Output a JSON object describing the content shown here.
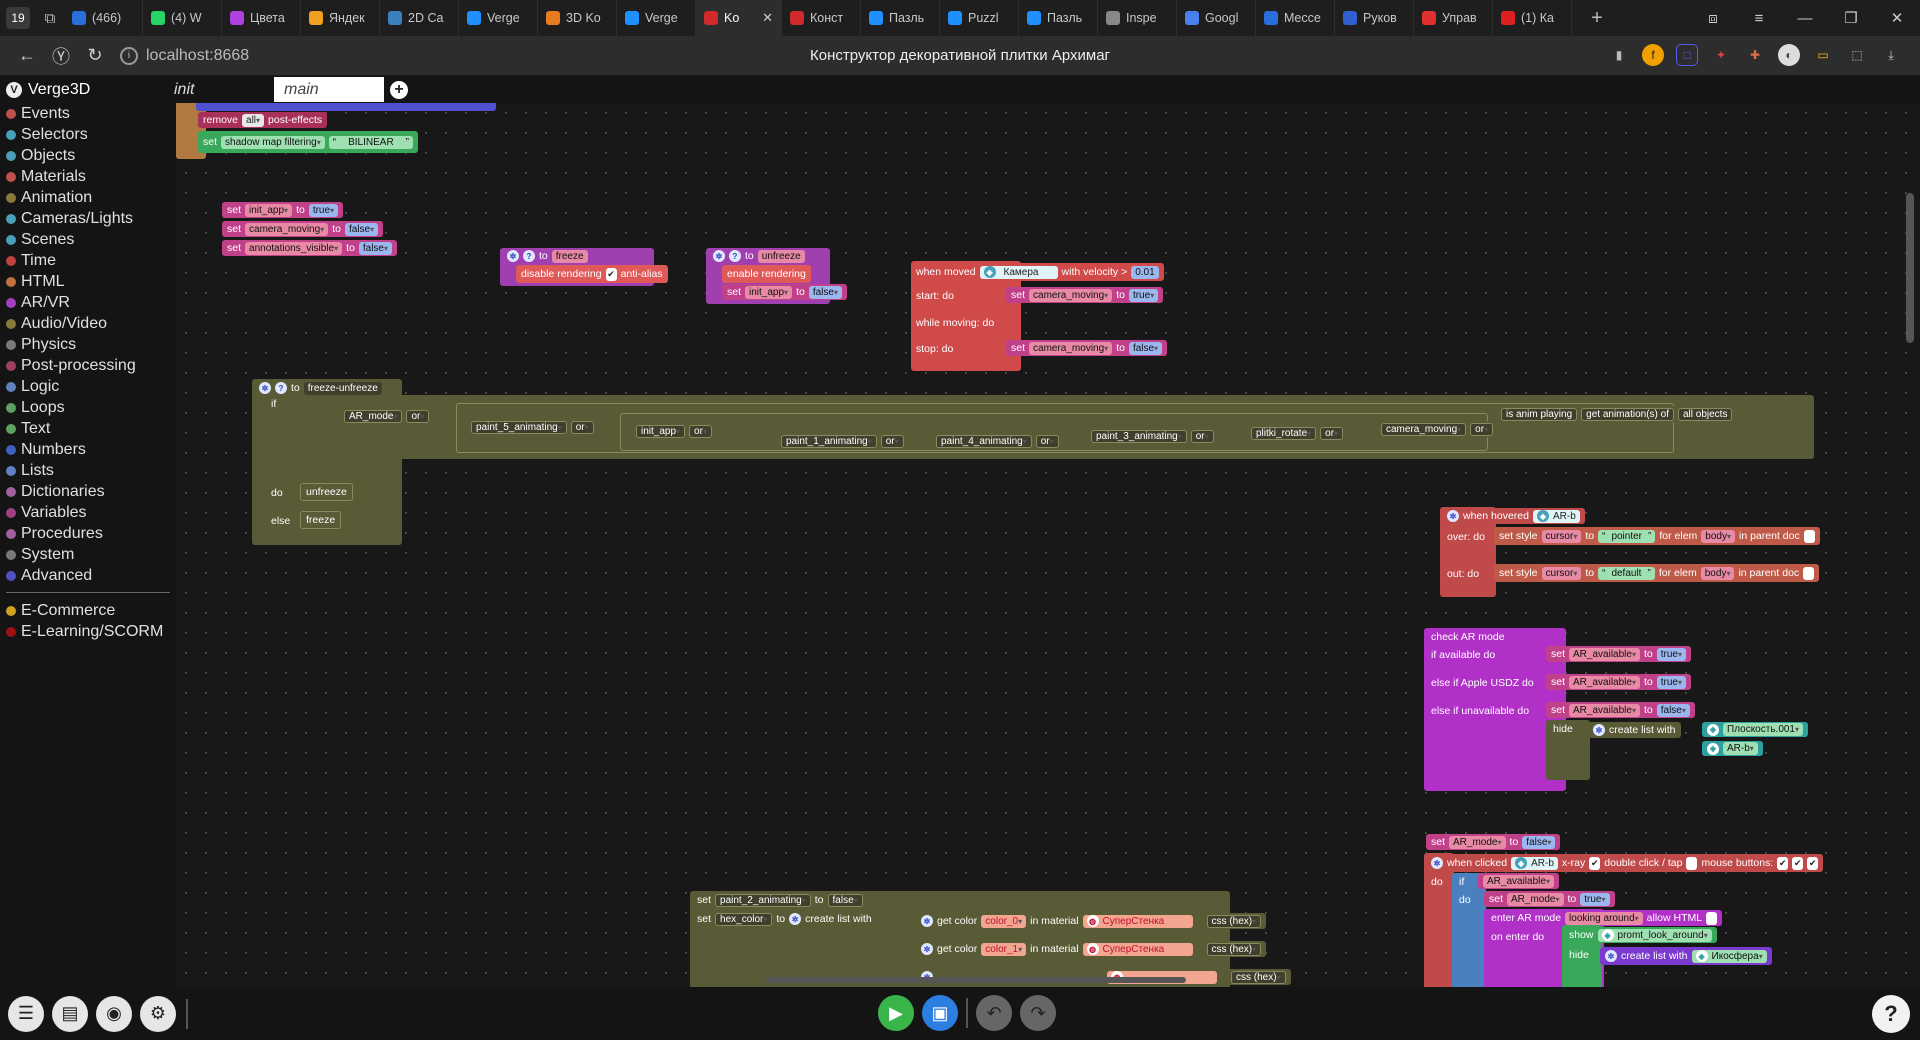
{
  "browser": {
    "tab_count": "19",
    "tabs": [
      {
        "label": "(466)",
        "color": "#2a6edc"
      },
      {
        "label": "(4) W",
        "color": "#25d366"
      },
      {
        "label": "Цвета",
        "color": "#b040e0"
      },
      {
        "label": "Яндек",
        "color": "#f0a020"
      },
      {
        "label": "2D Ca",
        "color": "#3a80c0"
      },
      {
        "label": "Verge",
        "color": "#1e90ff"
      },
      {
        "label": "3D Ko",
        "color": "#e87a20"
      },
      {
        "label": "Verge",
        "color": "#1e90ff"
      },
      {
        "label": "Ko",
        "color": "#d02a2a"
      },
      {
        "label": "Конст",
        "color": "#d02a2a"
      },
      {
        "label": "Пазль",
        "color": "#1e90ff"
      },
      {
        "label": "Puzzl",
        "color": "#1e90ff"
      },
      {
        "label": "Пазль",
        "color": "#1e90ff"
      },
      {
        "label": "Inspe",
        "color": "#888888"
      },
      {
        "label": "Googl",
        "color": "#4a80f0"
      },
      {
        "label": "Mecce",
        "color": "#2a6edc"
      },
      {
        "label": "Руков",
        "color": "#3060d0"
      },
      {
        "label": "Управ",
        "color": "#e03030"
      },
      {
        "label": "(1) Ка",
        "color": "#e02020"
      }
    ],
    "active_tab_index": 8,
    "url": "localhost:8668",
    "page_title": "Конструктор декоративной плитки Архимаг"
  },
  "app": {
    "name": "Verge3D",
    "tabs": [
      "init",
      "main"
    ]
  },
  "toolbox": {
    "categories": [
      {
        "label": "Events",
        "color": "#c0504d"
      },
      {
        "label": "Selectors",
        "color": "#4aa0b8"
      },
      {
        "label": "Objects",
        "color": "#4aa0b8"
      },
      {
        "label": "Materials",
        "color": "#c0504d"
      },
      {
        "label": "Animation",
        "color": "#8a7a3a"
      },
      {
        "label": "Cameras/Lights",
        "color": "#4aa0b8"
      },
      {
        "label": "Scenes",
        "color": "#4aa0b8"
      },
      {
        "label": "Time",
        "color": "#c04040"
      },
      {
        "label": "HTML",
        "color": "#c07040"
      },
      {
        "label": "AR/VR",
        "color": "#a040c0"
      },
      {
        "label": "Audio/Video",
        "color": "#8a7a3a"
      },
      {
        "label": "Physics",
        "color": "#7a7a7a"
      },
      {
        "label": "Post-processing",
        "color": "#a04060"
      },
      {
        "label": "Logic",
        "color": "#6080c0"
      },
      {
        "label": "Loops",
        "color": "#60a060"
      },
      {
        "label": "Text",
        "color": "#60a060"
      },
      {
        "label": "Numbers",
        "color": "#4060c0"
      },
      {
        "label": "Lists",
        "color": "#6080c0"
      },
      {
        "label": "Dictionaries",
        "color": "#a060a0"
      },
      {
        "label": "Variables",
        "color": "#a04080"
      },
      {
        "label": "Procedures",
        "color": "#a060a0"
      },
      {
        "label": "System",
        "color": "#7a7a7a"
      },
      {
        "label": "Advanced",
        "color": "#5050c0"
      }
    ],
    "plugins": [
      {
        "label": "E-Commerce",
        "color": "#d0a020"
      },
      {
        "label": "E-Learning/SCORM",
        "color": "#a01010"
      }
    ]
  },
  "blocks": {
    "postfx": {
      "line1_a": "remove",
      "line1_b": "all",
      "line1_c": "post-effects",
      "line2_a": "set",
      "line2_b": "shadow map filtering",
      "line2_c": "BILINEAR"
    },
    "vars1": [
      {
        "name": "init_app",
        "value": "true"
      },
      {
        "name": "camera_moving",
        "value": "false"
      },
      {
        "name": "annotations_visible",
        "value": "false"
      }
    ],
    "freeze": {
      "to": "to",
      "name": "freeze",
      "action": "disable rendering",
      "opt": "anti-alias"
    },
    "unfreeze": {
      "to": "to",
      "name": "unfreeze",
      "action": "enable rendering",
      "var": "init_app",
      "value": "false"
    },
    "moved": {
      "label": "when moved",
      "obj": "Камера",
      "velocity_label": "with velocity >",
      "velocity": "0.01",
      "start": "start: do",
      "while": "while moving: do",
      "stop": "stop: do",
      "var": "camera_moving",
      "start_val": "true",
      "stop_val": "false"
    },
    "fz": {
      "name": "freeze-unfreeze",
      "if": "if",
      "do": "do",
      "else": "else",
      "do_call": "unfreeze",
      "else_call": "freeze",
      "vars": [
        "AR_mode",
        "paint_5_animating",
        "init_app",
        "paint_1_animating",
        "paint_4_animating",
        "paint_3_animating",
        "plitki_rotate",
        "camera_moving"
      ],
      "anim_a": "is anim playing",
      "anim_b": "get animation(s) of",
      "anim_c": "all objects",
      "or": "or"
    },
    "hover": {
      "label": "when hovered",
      "obj": "AR-b",
      "over": "over: do",
      "out": "out: do",
      "style": "set style",
      "prop": "cursor",
      "to": "to",
      "v1": "pointer",
      "v2": "default",
      "for": "for elem",
      "elem": "body",
      "parent": "in parent doc"
    },
    "ar": {
      "label": "check AR mode",
      "if_avail": "if available do",
      "apple": "else if Apple USDZ do",
      "unavail": "else if unavailable do",
      "var": "AR_available",
      "v1": "true",
      "v2": "true",
      "v3": "false",
      "hide": "hide",
      "list": "create list with",
      "o1": "Плоскость.001",
      "o2": "AR-b"
    },
    "click": {
      "set_var": "AR_mode",
      "set_val": "false",
      "label": "when clicked",
      "obj": "AR-b",
      "xray": "x-ray",
      "dbl": "double click / tap",
      "mouse": "mouse buttons:",
      "do": "do",
      "if": "if",
      "cond": "AR_available",
      "set2": "AR_mode",
      "val2": "true",
      "enter": "enter AR mode",
      "mode": "looking around",
      "allow": "allow HTML",
      "on_enter": "on enter do",
      "show": "show",
      "show_obj": "promt_look_around",
      "hide": "hide",
      "hide_obj": "Икосфера"
    },
    "colors": {
      "var1": "paint_2_animating",
      "val1": "false",
      "var2": "hex_color",
      "list": "create list with",
      "get": "get color",
      "c0": "color_0",
      "c1": "color_1",
      "inmat": "in material",
      "mat": "СуперСтенка",
      "fmt": "css (hex)"
    }
  }
}
